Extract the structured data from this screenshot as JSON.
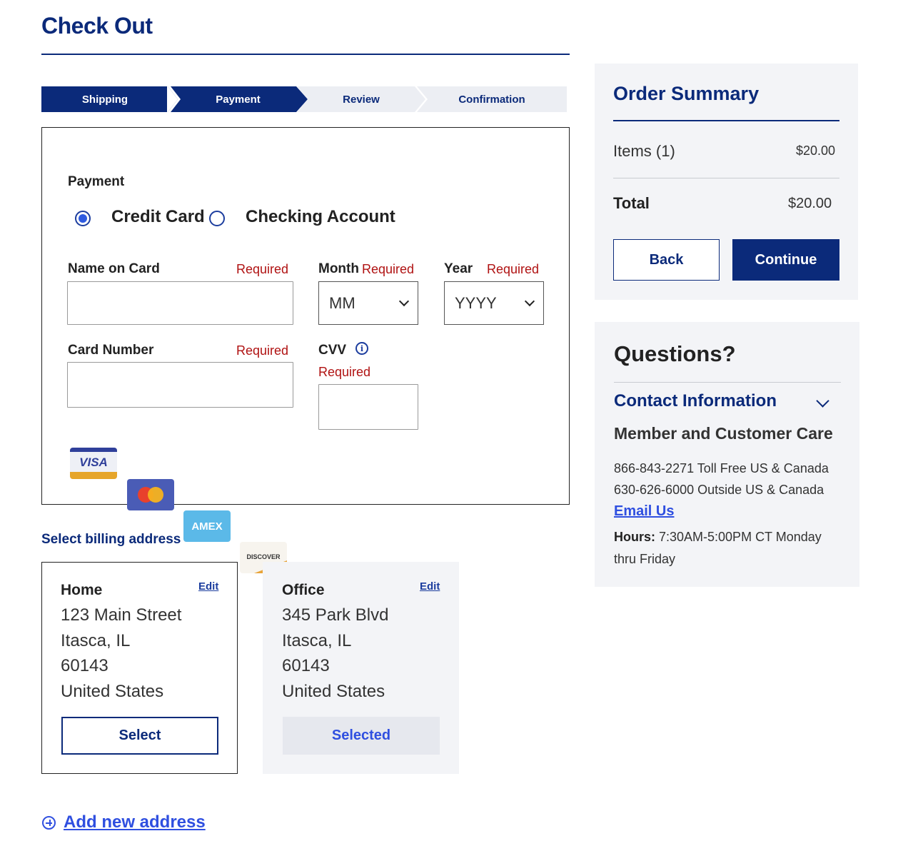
{
  "page": {
    "title": "Check Out"
  },
  "steps": [
    {
      "label": "Shipping",
      "state": "complete"
    },
    {
      "label": "Payment",
      "state": "active"
    },
    {
      "label": "Review",
      "state": "upcoming"
    },
    {
      "label": "Confirmation",
      "state": "upcoming"
    }
  ],
  "payment": {
    "heading": "Payment",
    "methods": [
      {
        "label": "Credit Card",
        "selected": true
      },
      {
        "label": "Checking Account",
        "selected": false
      }
    ],
    "fields": {
      "name_on_card": {
        "label": "Name on Card",
        "required": "Required",
        "value": ""
      },
      "month": {
        "label": "Month",
        "required": "Required",
        "value": "MM"
      },
      "year": {
        "label": "Year",
        "required": "Required",
        "value": "YYYY"
      },
      "card_number": {
        "label": "Card Number",
        "required": "Required",
        "value": ""
      },
      "cvv": {
        "label": "CVV",
        "required": "Required",
        "value": ""
      }
    },
    "cards": [
      {
        "name": "VISA",
        "icon": "visa-card-icon"
      },
      {
        "name": "mastercard",
        "icon": "mastercard-card-icon"
      },
      {
        "name": "AMEX",
        "icon": "amex-card-icon"
      },
      {
        "name": "DISCOVER",
        "icon": "discover-card-icon"
      }
    ]
  },
  "billing": {
    "title": "Select billing address",
    "addresses": [
      {
        "name": "Home",
        "edit": "Edit",
        "lines": [
          "123 Main Street",
          "Itasca, IL",
          "60143",
          "United States"
        ],
        "button": "Select",
        "selected": false
      },
      {
        "name": "Office",
        "edit": "Edit",
        "lines": [
          "345 Park Blvd",
          "Itasca, IL",
          "60143",
          "United States"
        ],
        "button": "Selected",
        "selected": true
      }
    ],
    "add_new": "Add new address"
  },
  "summary": {
    "title": "Order Summary",
    "items_label": "Items (1)",
    "items_value": "$20.00",
    "total_label": "Total",
    "total_value": "$20.00",
    "back": "Back",
    "continue": "Continue"
  },
  "questions": {
    "title": "Questions?",
    "contact_title": "Contact Information",
    "care_title": "Member and Customer Care",
    "phone1": "866-843-2271 Toll Free US & Canada",
    "phone2": "630-626-6000 Outside US & Canada",
    "email": "Email Us",
    "hours_label": "Hours:",
    "hours_value": " 7:30AM-5:00PM CT Monday thru Friday"
  },
  "colors": {
    "brand_navy": "#0b2a7a",
    "link_blue": "#2f4fe0",
    "required_red": "#b01212",
    "panel_gray": "#f3f4f7",
    "step_inactive": "#eceef3"
  }
}
